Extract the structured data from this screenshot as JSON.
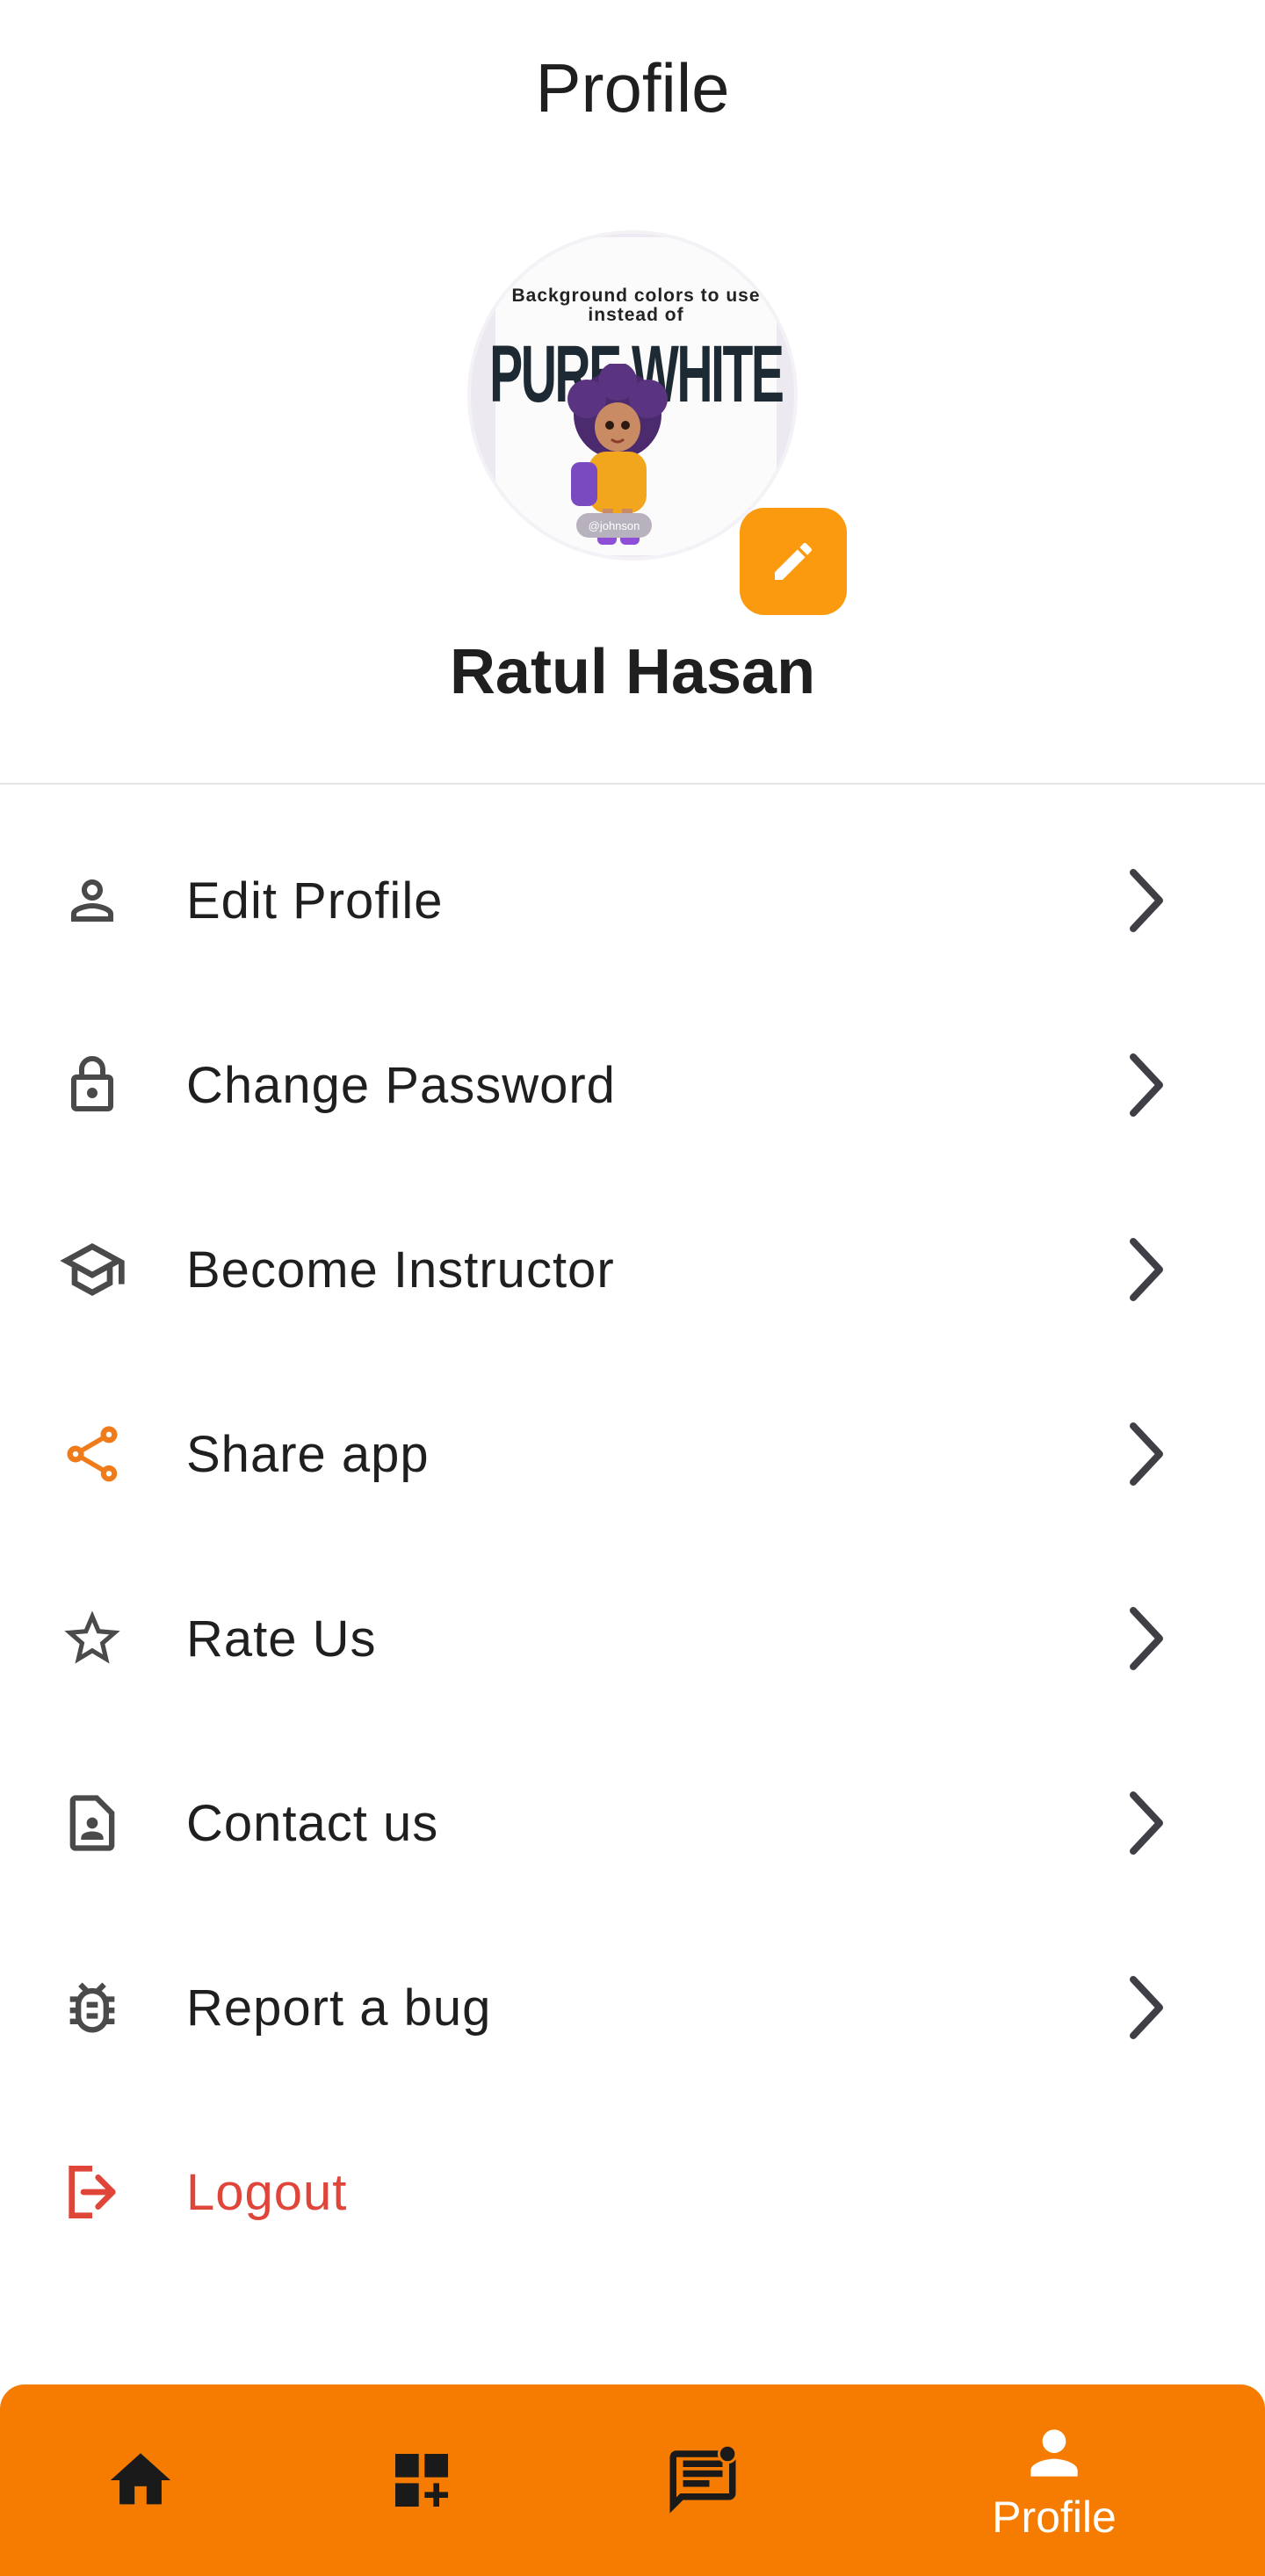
{
  "app_bar": {
    "title": "Profile"
  },
  "profile": {
    "name": "Ratul Hasan",
    "avatar_text_top": "Background colors to use instead of",
    "avatar_text_big": "PURE WHITE",
    "avatar_credit": "@johnson"
  },
  "menu": {
    "items": [
      {
        "label": "Edit Profile",
        "icon": "person-icon"
      },
      {
        "label": "Change Password",
        "icon": "lock-icon"
      },
      {
        "label": "Become Instructor",
        "icon": "school-icon"
      },
      {
        "label": "Share app",
        "icon": "share-icon"
      },
      {
        "label": "Rate Us",
        "icon": "star-icon"
      },
      {
        "label": "Contact us",
        "icon": "contact-icon"
      },
      {
        "label": "Report a bug",
        "icon": "bug-icon"
      },
      {
        "label": "Logout",
        "icon": "logout-icon"
      }
    ]
  },
  "bottom_nav": {
    "items": [
      {
        "icon": "home-icon"
      },
      {
        "icon": "dashboard-add-icon"
      },
      {
        "icon": "chat-icon",
        "badge": true
      },
      {
        "icon": "profile-icon",
        "label": "Profile",
        "active": true
      }
    ]
  },
  "colors": {
    "accent": "#f57c00",
    "edit_button": "#fb9a0e",
    "share_icon": "#f07b1a",
    "logout": "#e0453a",
    "icon": "#4a4a4a",
    "chevron": "#3f3f46"
  }
}
